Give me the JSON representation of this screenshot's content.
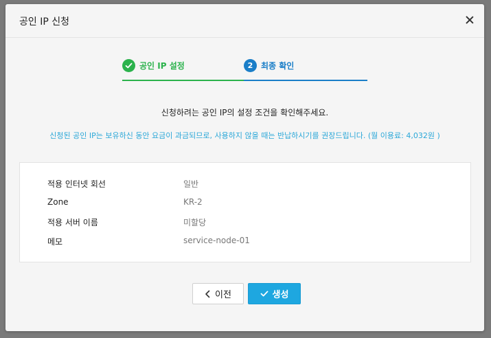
{
  "modal": {
    "title": "공인 IP 신청",
    "close_icon": "close-icon"
  },
  "steps": [
    {
      "number": "✓",
      "label": "공인 IP 설정",
      "state": "completed",
      "color": "#2bb24c"
    },
    {
      "number": "2",
      "label": "최종 확인",
      "state": "active",
      "color": "#1a7ec8"
    }
  ],
  "confirm_message": "신청하려는 공인 IP의 설정 조건을 확인해주세요.",
  "notice_message": "신청된 공인 IP는 보유하신 동안 요금이 과금되므로, 사용하지 않을 때는 반납하시기를 권장드립니다. (월 이용료: 4,032원 )",
  "info": [
    {
      "label": "적용 인터넷 회선",
      "value": "일반"
    },
    {
      "label": "Zone",
      "value": "KR-2"
    },
    {
      "label": "적용 서버 이름",
      "value": "미할당"
    },
    {
      "label": "메모",
      "value": "service-node-01"
    }
  ],
  "buttons": {
    "prev_label": "이전",
    "create_label": "생성"
  }
}
